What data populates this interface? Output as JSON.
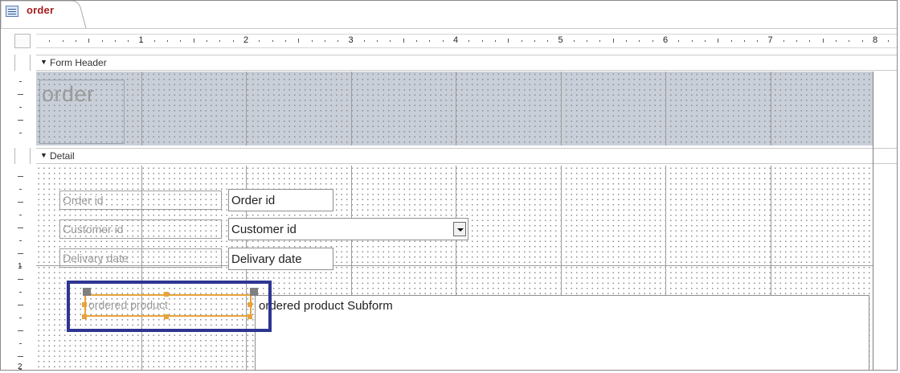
{
  "tab": {
    "title": "order",
    "icon": "form-icon"
  },
  "ruler": {
    "horizontal_numbers": [
      "1",
      "2",
      "3",
      "4",
      "5",
      "6",
      "7",
      "8"
    ],
    "vertical_numbers": [
      "1",
      "2"
    ]
  },
  "sections": {
    "form_header": "Form Header",
    "detail": "Detail"
  },
  "header": {
    "title_label": "order"
  },
  "detail": {
    "order_id_label": "Order id",
    "order_id_field": "Order id",
    "customer_id_label": "Customer id",
    "customer_id_field": "Customer id",
    "delivary_date_label": "Delivary date",
    "delivary_date_field": "Delivary date",
    "ordered_product_label": "ordered product",
    "subform_label": "ordered product Subform"
  },
  "colors": {
    "selection": "#e8a33a",
    "highlight_box": "#2e3592",
    "header_background": "#c9cfd9",
    "tab_title": "#a61d1d"
  }
}
